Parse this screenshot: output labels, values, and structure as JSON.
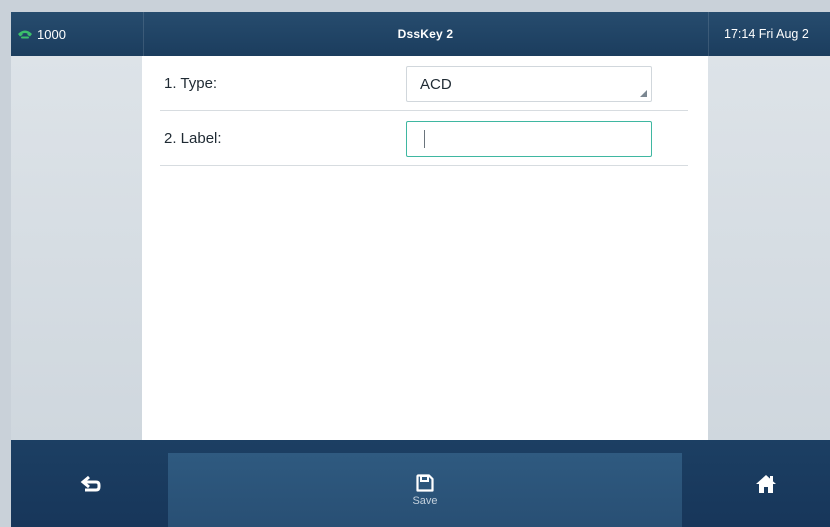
{
  "status_bar": {
    "account": "1000",
    "title": "DssKey 2",
    "datetime": "17:14 Fri Aug 2",
    "icon": "phone-handset-icon"
  },
  "form": {
    "type_label": "1. Type:",
    "type_value": "ACD",
    "label_label": "2. Label:",
    "label_value": ""
  },
  "softkeys": {
    "back_icon": "back-arrow-icon",
    "save_label": "Save",
    "save_icon": "save-icon",
    "home_icon": "home-icon"
  },
  "colors": {
    "bar_dark": "#1b3d5e",
    "accent_focus": "#3fb7a1",
    "phone_icon": "#3bbf6b"
  }
}
